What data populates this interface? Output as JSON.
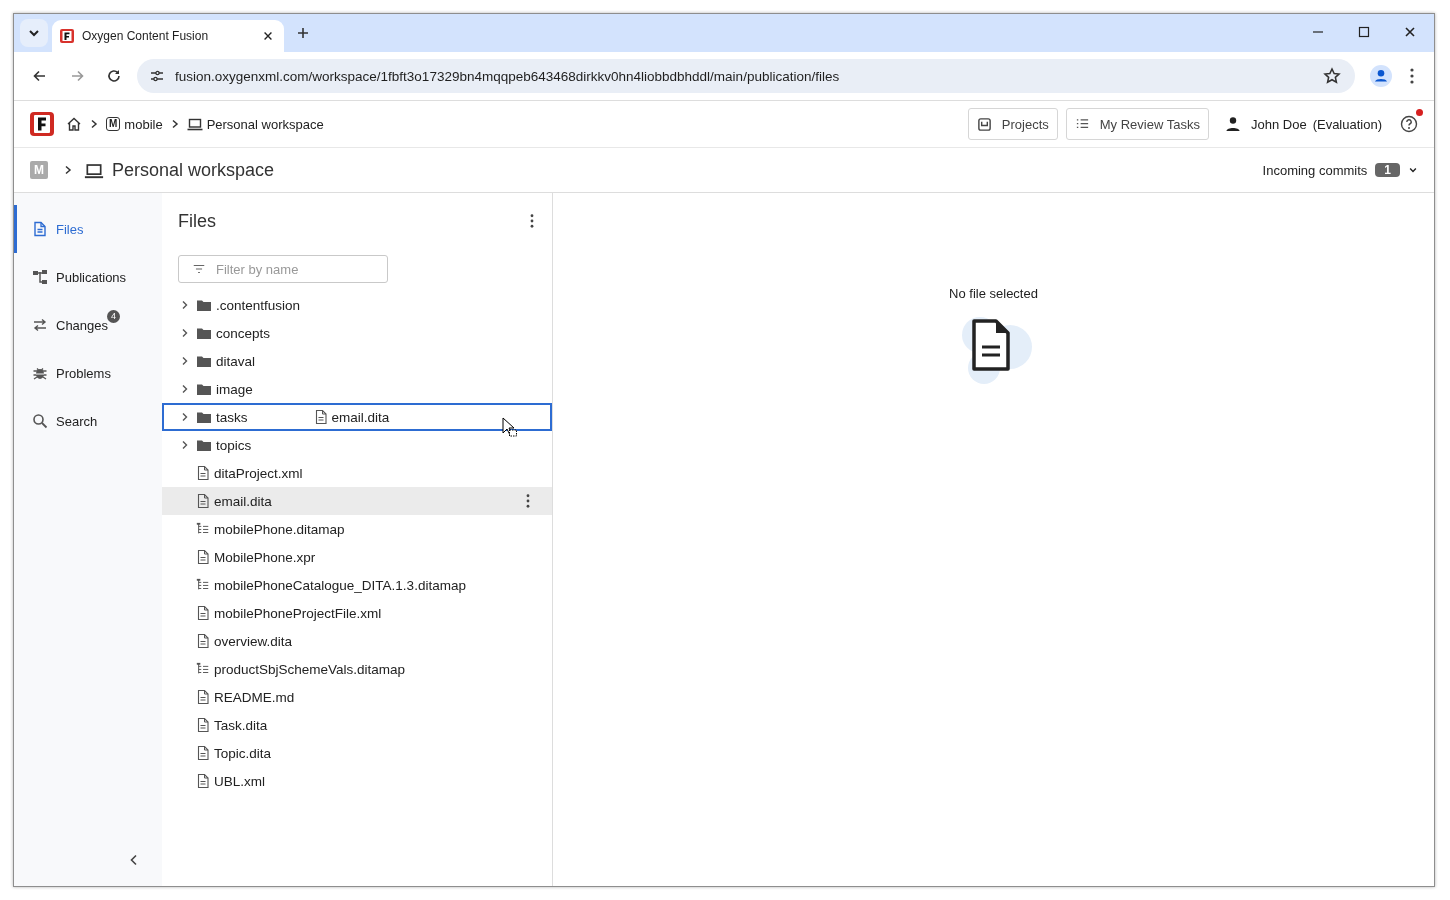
{
  "browser": {
    "tab_title": "Oxygen Content Fusion",
    "url": "fusion.oxygenxml.com/workspace/1fbft3o17329bn4mqqpeb643468dirkkv0hn4liobbdbhddl/main/publication/files"
  },
  "breadcrumb": [
    {
      "kind": "home"
    },
    {
      "kind": "project",
      "badge": "M",
      "label": "mobile"
    },
    {
      "kind": "workspace",
      "label": "Personal workspace"
    }
  ],
  "header_buttons": [
    {
      "kind": "projects",
      "label": "Projects"
    },
    {
      "kind": "tasks",
      "label": "My Review Tasks"
    }
  ],
  "user": {
    "name": "John Doe",
    "note": "(Evaluation)"
  },
  "help": {
    "notification": true
  },
  "workspace_bar": {
    "badge": "M",
    "title": "Personal workspace",
    "incoming_label": "Incoming commits",
    "incoming_count": "1"
  },
  "sidebar": {
    "items": [
      {
        "kind": "files",
        "label": "Files",
        "selected": true
      },
      {
        "kind": "publications",
        "label": "Publications",
        "selected": false
      },
      {
        "kind": "changes",
        "label": "Changes",
        "badge": "4",
        "selected": false
      },
      {
        "kind": "problems",
        "label": "Problems",
        "selected": false
      },
      {
        "kind": "search",
        "label": "Search",
        "selected": false
      }
    ]
  },
  "files_panel": {
    "title": "Files",
    "filter_placeholder": "Filter by name",
    "tree": [
      {
        "kind": "folder",
        "name": ".contentfusion",
        "selected": false,
        "drop_target": false
      },
      {
        "kind": "folder",
        "name": "concepts",
        "selected": false,
        "drop_target": false
      },
      {
        "kind": "folder",
        "name": "ditaval",
        "selected": false,
        "drop_target": false
      },
      {
        "kind": "folder",
        "name": "image",
        "selected": false,
        "drop_target": false
      },
      {
        "kind": "folder",
        "name": "tasks",
        "selected": false,
        "drop_target": true,
        "drag_label": "email.dita"
      },
      {
        "kind": "folder",
        "name": "topics",
        "selected": false,
        "drop_target": false
      },
      {
        "kind": "file",
        "name": "ditaProject.xml",
        "selected": false,
        "drop_target": false
      },
      {
        "kind": "file",
        "name": "email.dita",
        "selected": true,
        "drop_target": false
      },
      {
        "kind": "map",
        "name": "mobilePhone.ditamap",
        "selected": false,
        "drop_target": false
      },
      {
        "kind": "file",
        "name": "MobilePhone.xpr",
        "selected": false,
        "drop_target": false
      },
      {
        "kind": "map",
        "name": "mobilePhoneCatalogue_DITA.1.3.ditamap",
        "selected": false,
        "drop_target": false
      },
      {
        "kind": "file",
        "name": "mobilePhoneProjectFile.xml",
        "selected": false,
        "drop_target": false
      },
      {
        "kind": "file",
        "name": "overview.dita",
        "selected": false,
        "drop_target": false
      },
      {
        "kind": "map",
        "name": "productSbjSchemeVals.ditamap",
        "selected": false,
        "drop_target": false
      },
      {
        "kind": "file",
        "name": "README.md",
        "selected": false,
        "drop_target": false
      },
      {
        "kind": "file",
        "name": "Task.dita",
        "selected": false,
        "drop_target": false
      },
      {
        "kind": "file",
        "name": "Topic.dita",
        "selected": false,
        "drop_target": false
      },
      {
        "kind": "file",
        "name": "UBL.xml",
        "selected": false,
        "drop_target": false
      }
    ]
  },
  "preview": {
    "message": "No file selected"
  }
}
